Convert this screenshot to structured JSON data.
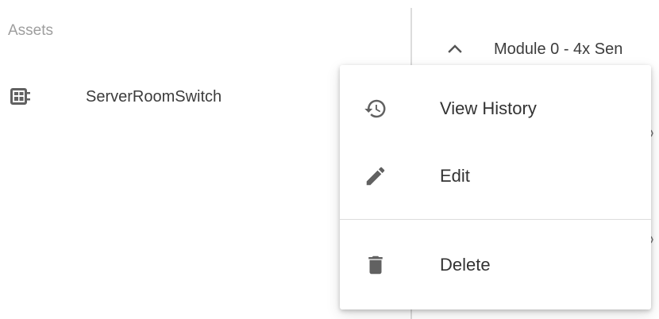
{
  "assets_panel": {
    "title": "Assets",
    "items": [
      {
        "label": "ServerRoomSwitch",
        "icon": "device-module-icon"
      }
    ]
  },
  "right_panel": {
    "module_title": "Module 0 - 4x Sen"
  },
  "context_menu": {
    "items": [
      {
        "label": "View History",
        "icon": "history-icon"
      },
      {
        "label": "Edit",
        "icon": "pencil-icon"
      },
      {
        "label": "Delete",
        "icon": "trash-icon"
      }
    ]
  },
  "colors": {
    "icon": "#616161",
    "text": "#333333",
    "muted_text": "#9e9e9e",
    "divider": "#dcdcdc"
  }
}
